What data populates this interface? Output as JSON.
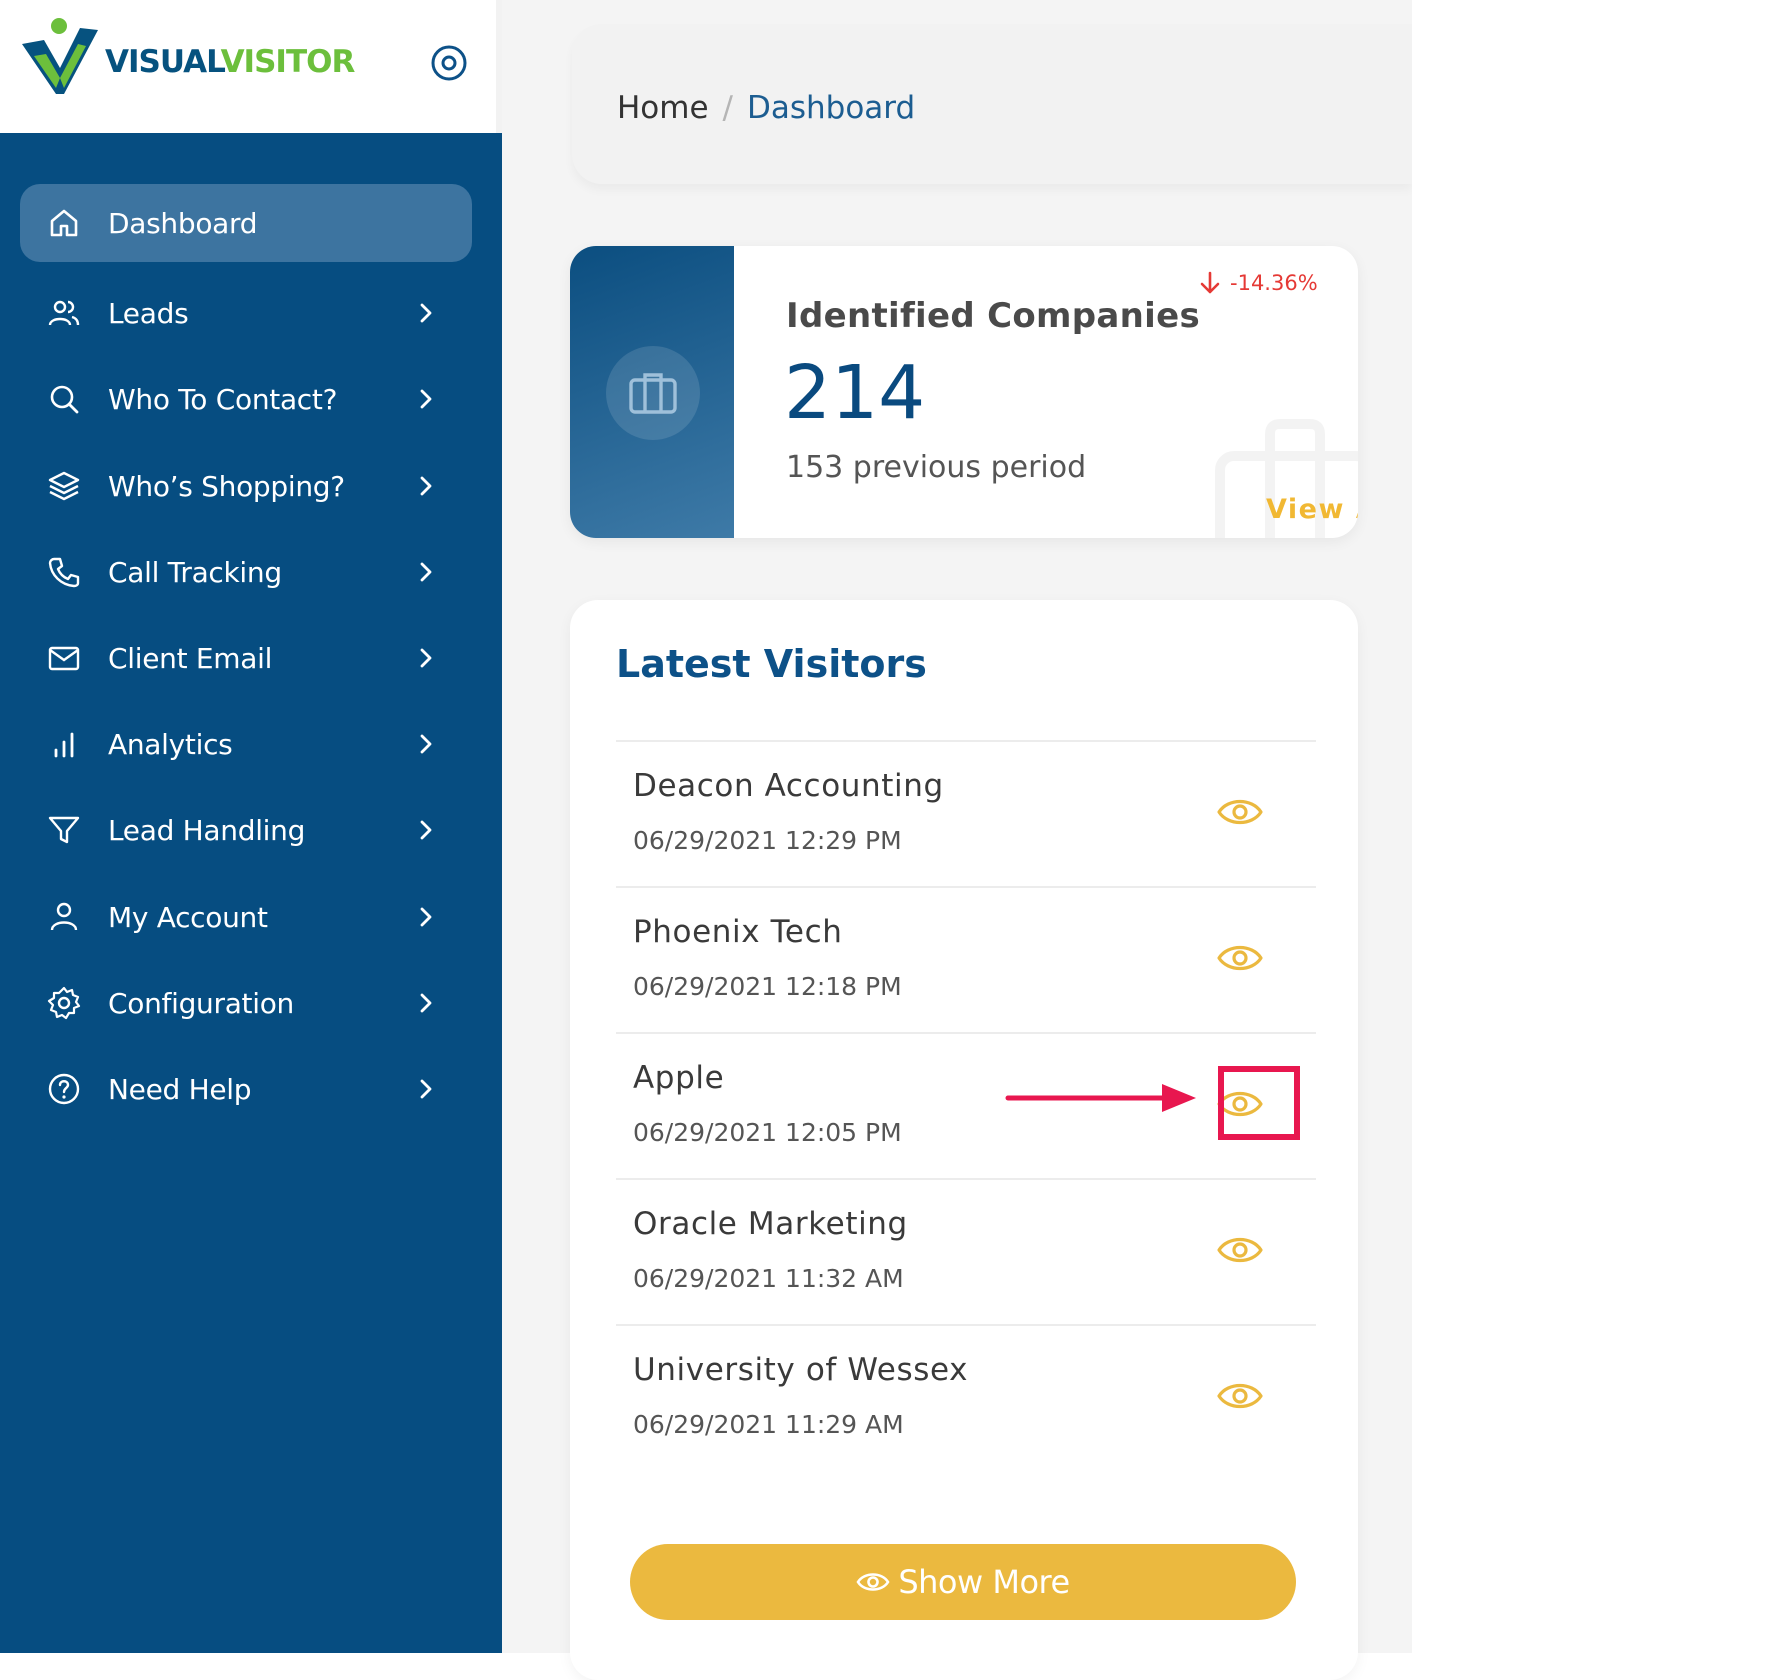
{
  "brand": {
    "logo_text_primary": "VISUAL",
    "logo_text_secondary": "VISITOR",
    "primary_color": "#064d81",
    "accent_color": "#6cbf3c",
    "highlight_color": "#ebb93f"
  },
  "sidebar": {
    "items": [
      {
        "label": "Dashboard",
        "icon": "home-icon",
        "active": true
      },
      {
        "label": "Leads",
        "icon": "users-icon"
      },
      {
        "label": "Who To Contact?",
        "icon": "search-icon"
      },
      {
        "label": "Who’s Shopping?",
        "icon": "layers-icon"
      },
      {
        "label": "Call Tracking",
        "icon": "phone-icon"
      },
      {
        "label": "Client Email",
        "icon": "mail-icon"
      },
      {
        "label": "Analytics",
        "icon": "bar-chart-icon"
      },
      {
        "label": "Lead Handling",
        "icon": "filter-icon"
      },
      {
        "label": "My Account",
        "icon": "user-icon"
      },
      {
        "label": "Configuration",
        "icon": "gear-icon"
      },
      {
        "label": "Need Help",
        "icon": "help-circle-icon"
      }
    ]
  },
  "breadcrumb": {
    "home": "Home",
    "separator": "/",
    "current": "Dashboard"
  },
  "stat_card": {
    "title": "Identified Companies",
    "value": "214",
    "previous": "153 previous period",
    "change": "-14.36%",
    "change_color": "#e53935",
    "view_all": "View All"
  },
  "visitors": {
    "title": "Latest Visitors",
    "rows": [
      {
        "name": "Deacon Accounting",
        "time": "06/29/2021 12:29 PM"
      },
      {
        "name": "Phoenix Tech",
        "time": "06/29/2021 12:18 PM"
      },
      {
        "name": "Apple",
        "time": "06/29/2021 12:05 PM"
      },
      {
        "name": "Oracle Marketing",
        "time": "06/29/2021 11:32 AM"
      },
      {
        "name": "University of Wessex",
        "time": "06/29/2021 11:29 AM"
      }
    ],
    "show_more": "Show More"
  }
}
